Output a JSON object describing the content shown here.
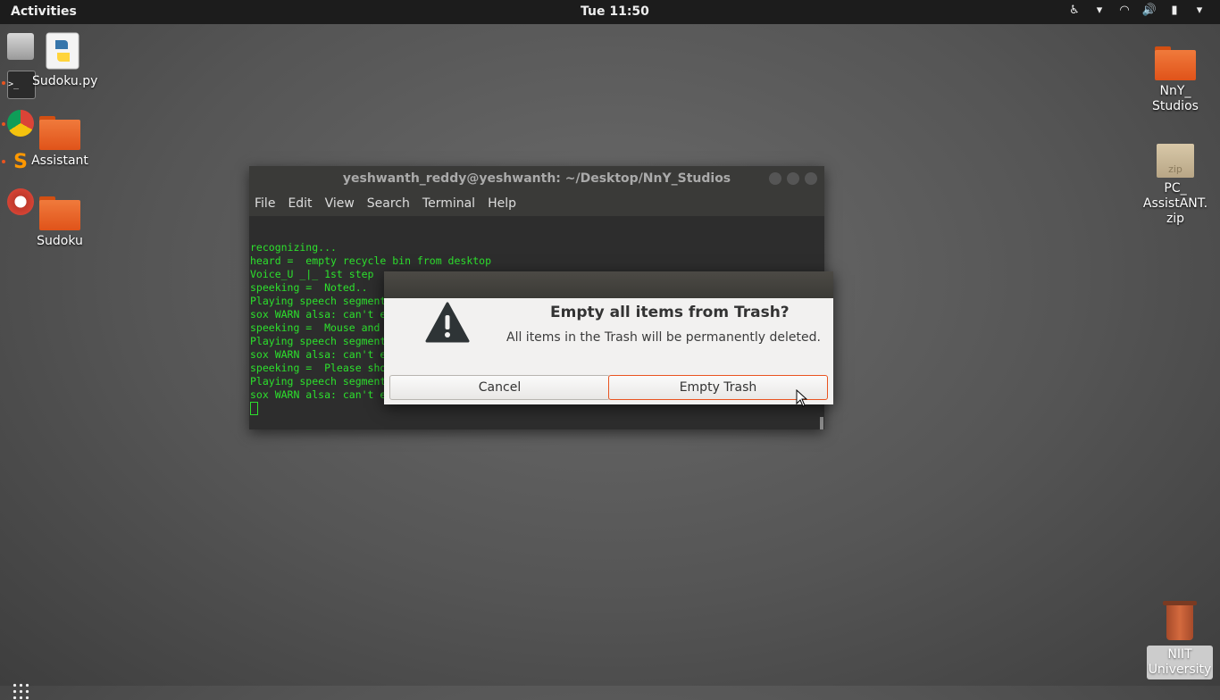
{
  "topbar": {
    "activities": "Activities",
    "clock": "Tue 11:50"
  },
  "desktop": {
    "left_icons": [
      {
        "label": "Sudoku.py"
      },
      {
        "label": "Assistant"
      },
      {
        "label": "Sudoku"
      }
    ],
    "right_icons": [
      {
        "label_line1": "NnY_",
        "label_line2": "Studios"
      },
      {
        "label_line1": "PC_",
        "label_line2": "AssistANT.",
        "label_line3": "zip",
        "badge": "zip"
      }
    ],
    "trash": {
      "line1": "NIIT",
      "line2": "University"
    }
  },
  "terminal": {
    "title": "yeshwanth_reddy@yeshwanth: ~/Desktop/NnY_Studios",
    "menu": [
      "File",
      "Edit",
      "View",
      "Search",
      "Terminal",
      "Help"
    ],
    "lines": [
      "recognizing...",
      "heard =  empty recycle bin from desktop",
      "Voice_U _|_ 1st step",
      "",
      "speeking =  Noted..",
      "Playing speech segment",
      "sox WARN alsa: can't e",
      "speeking =  Mouse and",
      "Playing speech segment",
      "sox WARN alsa: can't e",
      "speeking =  Please sho",
      "Playing speech segment",
      "sox WARN alsa: can't encode 0-bit Unknown or not applicable"
    ]
  },
  "dialog": {
    "title": "Empty all items from Trash?",
    "message": "All items in the Trash will be permanently deleted.",
    "cancel_label": "Cancel",
    "confirm_label": "Empty Trash"
  },
  "colors": {
    "accent": "#e95420",
    "terminal_text": "#2de02d"
  }
}
